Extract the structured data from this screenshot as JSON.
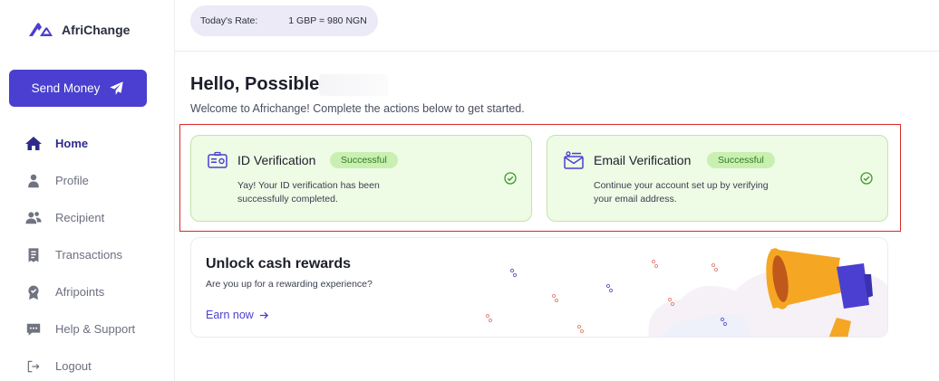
{
  "brand": {
    "name": "AfriChange",
    "accent": "#4a3fd0",
    "success": "#2f7a1e",
    "highlight": "#d92a2a"
  },
  "sidebar": {
    "send_button": {
      "label": "Send Money",
      "icon": "paper-plane-icon"
    },
    "items": [
      {
        "label": "Home",
        "icon": "home-icon",
        "active": true
      },
      {
        "label": "Profile",
        "icon": "person-icon"
      },
      {
        "label": "Recipient",
        "icon": "people-icon"
      },
      {
        "label": "Transactions",
        "icon": "receipt-icon"
      },
      {
        "label": "Afripoints",
        "icon": "medal-icon"
      },
      {
        "label": "Help & Support",
        "icon": "chat-icon"
      },
      {
        "label": "Logout",
        "icon": "logout-icon"
      }
    ]
  },
  "topbar": {
    "rate_label": "Today's Rate:",
    "rate_value": "1 GBP = 980 NGN"
  },
  "greeting": {
    "title": "Hello, Possible",
    "subtitle": "Welcome to Africhange! Complete the actions below to get started."
  },
  "verifications": [
    {
      "title": "ID Verification",
      "status": "Successful",
      "description": "Yay! Your ID verification has been successfully completed.",
      "icon": "id-card-icon"
    },
    {
      "title": "Email Verification",
      "status": "Successful",
      "description": "Continue your account set up by verifying your email address.",
      "icon": "envelope-icon"
    }
  ],
  "rewards": {
    "title": "Unlock cash rewards",
    "subtitle": "Are you up for a rewarding experience?",
    "link": "Earn now",
    "icon": "megaphone-icon"
  }
}
